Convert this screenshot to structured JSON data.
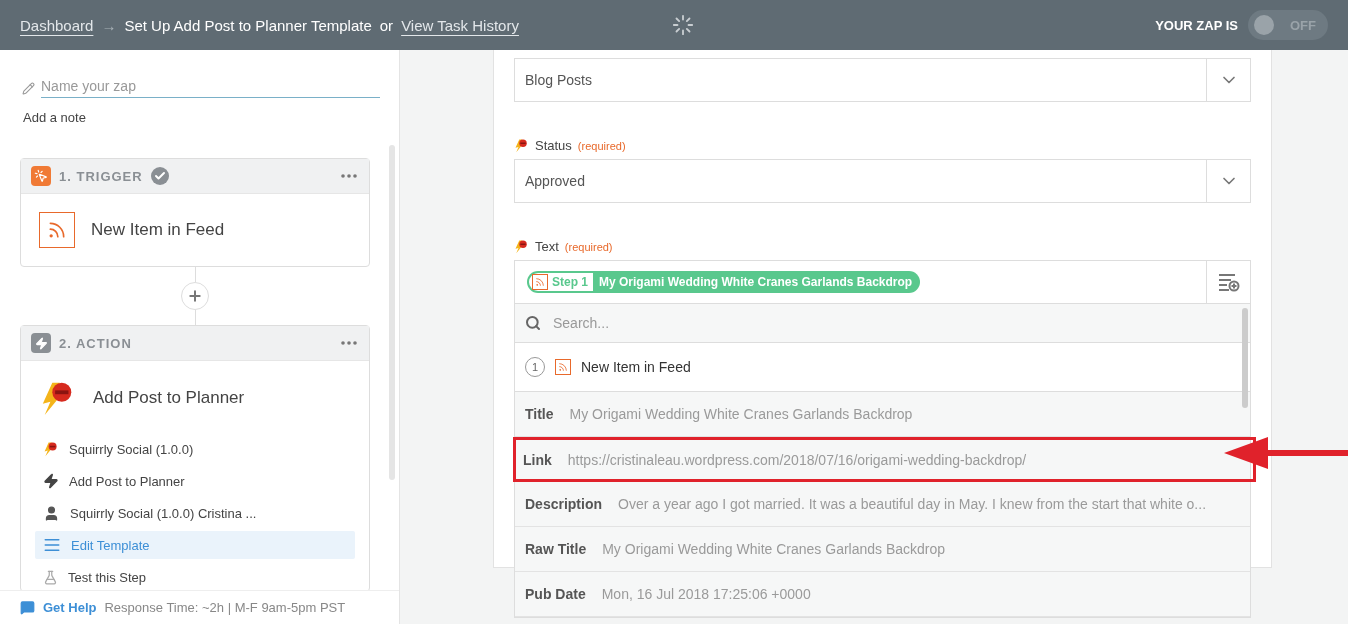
{
  "header": {
    "dashboard_link": "Dashboard",
    "arrow": "→",
    "title": "Set Up Add Post to Planner Template",
    "or_text": "or",
    "history_link": "View Task History",
    "zap_label": "YOUR ZAP IS",
    "zap_on": false,
    "zap_state": "OFF"
  },
  "sidebar": {
    "name_placeholder": "Name your zap",
    "add_note": "Add a note",
    "steps": [
      {
        "kind": "trigger",
        "heading": "1. TRIGGER",
        "completed": true,
        "app_title": "New Item in Feed"
      },
      {
        "kind": "action",
        "heading": "2. ACTION",
        "completed": false,
        "app_title": "Add Post to Planner",
        "items": [
          {
            "kind": "app",
            "label": "Squirrly Social (1.0.0)",
            "selected": false
          },
          {
            "kind": "event",
            "label": "Add Post to Planner",
            "selected": false
          },
          {
            "kind": "account",
            "label": "Squirrly Social (1.0.0) Cristina ...",
            "selected": false
          },
          {
            "kind": "template",
            "label": "Edit Template",
            "selected": true
          },
          {
            "kind": "test",
            "label": "Test this Step",
            "selected": false
          }
        ]
      }
    ],
    "help_link": "Get Help",
    "help_info": "Response Time: ~2h | M-F 9am-5pm PST"
  },
  "form": {
    "fields": [
      {
        "kind": "select",
        "value": "Blog Posts"
      },
      {
        "kind": "select",
        "label": "Status",
        "required": "(required)",
        "value": "Approved"
      },
      {
        "kind": "tokens",
        "label": "Text",
        "required": "(required)",
        "token_step": "Step 1",
        "token_value": "My Origami Wedding White Cranes Garlands Backdrop"
      }
    ],
    "dropdown": {
      "search_placeholder": "Search...",
      "group_number": "1",
      "group_title": "New Item in Feed",
      "rows": [
        {
          "key": "Title",
          "value": "My Origami Wedding White Cranes Garlands Backdrop",
          "highlighted": false
        },
        {
          "key": "Link",
          "value": "https://cristinaleau.wordpress.com/2018/07/16/origami-wedding-backdrop/",
          "highlighted": true
        },
        {
          "key": "Description",
          "value": "Over a year ago I got married. It was a beautiful day in May. I knew from the start that white o...",
          "highlighted": false
        },
        {
          "key": "Raw Title",
          "value": "My Origami Wedding White Cranes Garlands Backdrop",
          "highlighted": false
        },
        {
          "key": "Pub Date",
          "value": "Mon, 16 Jul 2018 17:25:06 +0000",
          "highlighted": false
        }
      ]
    }
  }
}
